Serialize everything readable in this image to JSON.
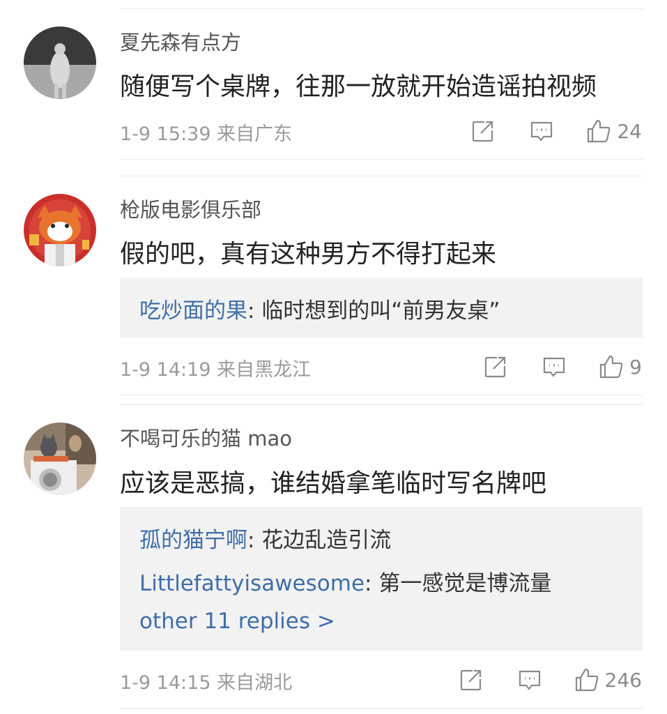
{
  "comments": [
    {
      "username": "夏先森有点方",
      "content": "随便写个桌牌，往那一放就开始造谣拍视频",
      "time": "1-9 15:39",
      "location": "来自广东",
      "likes": "24",
      "replies": [],
      "more_replies": ""
    },
    {
      "username": "枪版电影俱乐部",
      "content": "假的吧，真有这种男方不得打起来",
      "time": "1-9 14:19",
      "location": "来自黑龙江",
      "likes": "9",
      "replies": [
        {
          "name": "吃炒面的果",
          "sep": ": ",
          "text": "临时想到的叫“前男友桌”"
        }
      ],
      "more_replies": ""
    },
    {
      "username": "不喝可乐的猫 mao",
      "content": "应该是恶搞，谁结婚拿笔临时写名牌吧",
      "time": "1-9 14:15",
      "location": "来自湖北",
      "likes": "246",
      "replies": [
        {
          "name": "孤的猫宁啊",
          "sep": ": ",
          "text": "花边乱造引流"
        },
        {
          "name": "Littlefattyisawesome",
          "sep": ": ",
          "text": "第一感觉是博流量"
        }
      ],
      "more_replies": "other 11 replies >"
    }
  ],
  "icons": {
    "share": "share-icon",
    "comment": "comment-icon",
    "like": "like-icon"
  },
  "colors": {
    "link": "#3f6ea8",
    "meta": "#9a9a9a",
    "reply_bg": "#f2f2f2"
  }
}
